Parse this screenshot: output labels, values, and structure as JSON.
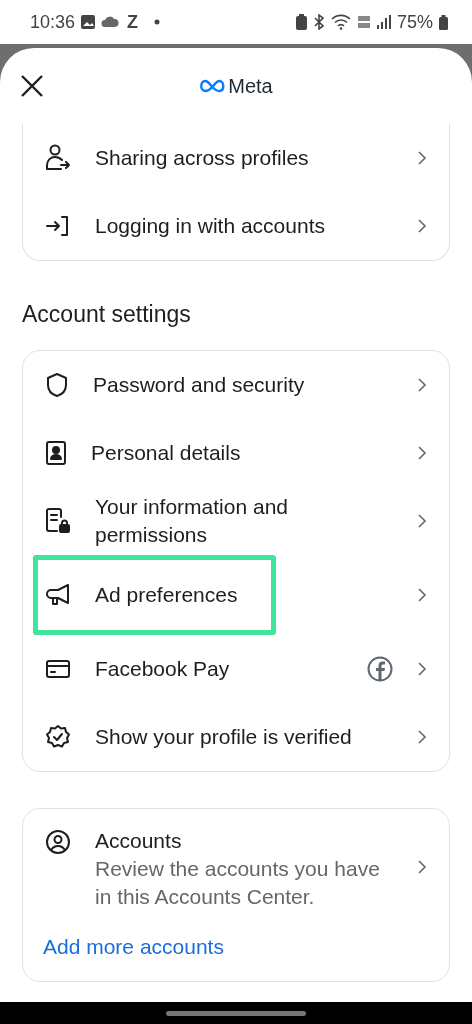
{
  "status_bar": {
    "time": "10:36",
    "notification_letter": "Z",
    "battery": "75%"
  },
  "header": {
    "title": "Meta"
  },
  "top_card": {
    "items": [
      {
        "label": "Sharing across profiles"
      },
      {
        "label": "Logging in with accounts"
      }
    ]
  },
  "account_settings": {
    "heading": "Account settings",
    "items": [
      {
        "label": "Password and security",
        "highlighted": false,
        "badge": false
      },
      {
        "label": "Personal details",
        "highlighted": false,
        "badge": false
      },
      {
        "label": "Your information and permissions",
        "highlighted": false,
        "badge": false
      },
      {
        "label": "Ad preferences",
        "highlighted": true,
        "badge": false
      },
      {
        "label": "Facebook Pay",
        "highlighted": false,
        "badge": true
      },
      {
        "label": "Show your profile is verified",
        "highlighted": false,
        "badge": false
      }
    ]
  },
  "accounts_card": {
    "title": "Accounts",
    "description": "Review the accounts you have in this Accounts Center.",
    "link": "Add more accounts"
  }
}
